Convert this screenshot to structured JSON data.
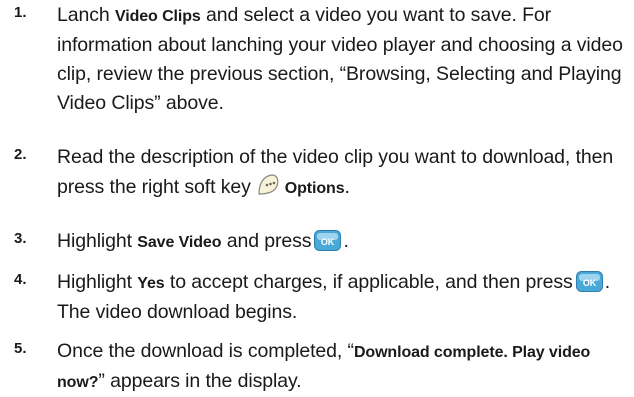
{
  "steps": [
    {
      "number": "1.",
      "a": "Lanch ",
      "b": "Video Clips",
      "c": " and select a video you want to save. For information about lanching your video player and choosing a video clip, review the previous section, “Browsing, Selecting and Playing Video Clips” above."
    },
    {
      "number": "2.",
      "a": "Read the description of the video clip you want to download, then press the right soft key",
      "icon": "soft-key-icon",
      "b": "Options",
      "c": "."
    },
    {
      "number": "3.",
      "a": "Highlight ",
      "b": "Save Video",
      "c": " and press",
      "icon": "ok-key-icon",
      "d": "."
    },
    {
      "number": "4.",
      "a": "Highlight ",
      "b": "Yes",
      "c": " to accept charges, if applicable, and then press",
      "icon": "ok-key-icon",
      "d": ".  The video download begins."
    },
    {
      "number": "5.",
      "a": "Once the download is completed, “",
      "b": "Download complete. Play video now?",
      "c": "” appears in the display."
    }
  ],
  "colors": {
    "text": "#1a1a1a",
    "ok_key": "#4aa8d8"
  }
}
